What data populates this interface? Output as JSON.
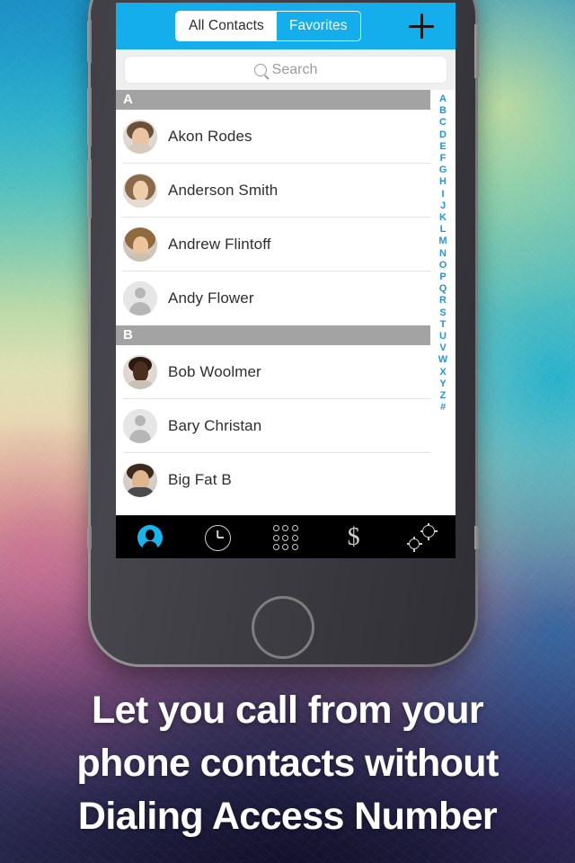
{
  "app": {
    "accent_color": "#14aeec",
    "header": {
      "tabs": [
        {
          "label": "All Contacts",
          "selected": true
        },
        {
          "label": "Favorites",
          "selected": false
        }
      ],
      "add_button_label": "+"
    },
    "search": {
      "placeholder": "Search",
      "value": "",
      "icon": "search-icon"
    },
    "sections": [
      {
        "letter": "A",
        "contacts": [
          {
            "name": "Akon Rodes",
            "avatar": "photo"
          },
          {
            "name": "Anderson Smith",
            "avatar": "photo"
          },
          {
            "name": "Andrew Flintoff",
            "avatar": "photo"
          },
          {
            "name": "Andy Flower",
            "avatar": "placeholder"
          }
        ]
      },
      {
        "letter": "B",
        "contacts": [
          {
            "name": "Bob Woolmer",
            "avatar": "photo"
          },
          {
            "name": "Bary Christan",
            "avatar": "placeholder"
          },
          {
            "name": "Big Fat B",
            "avatar": "photo"
          }
        ]
      }
    ],
    "alpha_index": [
      "A",
      "B",
      "C",
      "D",
      "E",
      "F",
      "G",
      "H",
      "I",
      "J",
      "K",
      "L",
      "M",
      "N",
      "O",
      "P",
      "Q",
      "R",
      "S",
      "T",
      "U",
      "V",
      "W",
      "X",
      "Y",
      "Z",
      "#"
    ],
    "alpha_index_color": "#2196dd",
    "tab_bar": {
      "background_color": "#000000",
      "items": [
        {
          "icon": "contacts-icon",
          "active": true
        },
        {
          "icon": "recents-clock-icon",
          "active": false
        },
        {
          "icon": "keypad-icon",
          "active": false
        },
        {
          "icon": "dollar-balance-icon",
          "active": false
        },
        {
          "icon": "settings-gears-icon",
          "active": false
        }
      ]
    }
  },
  "caption": {
    "lines": [
      "Let you call from your",
      "phone contacts without",
      "Dialing Access Number"
    ]
  }
}
